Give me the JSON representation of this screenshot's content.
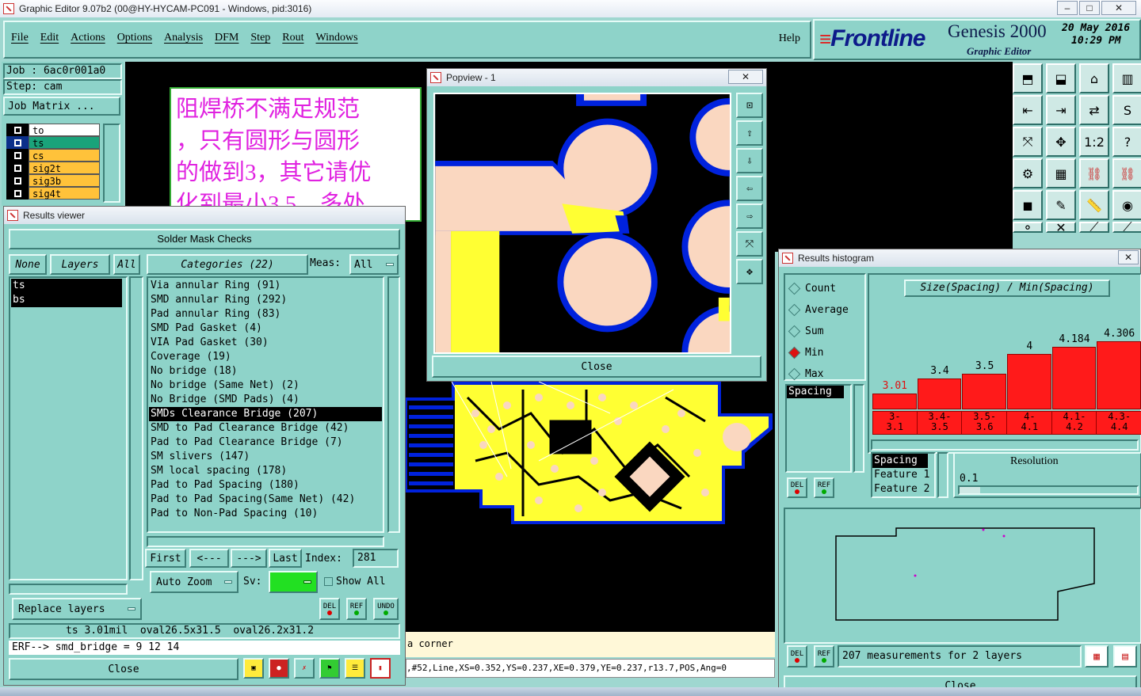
{
  "window": {
    "title": "Graphic Editor 9.07b2 (00@HY-HYCAM-PC091 - Windows, pid:3016)"
  },
  "menu": [
    "File",
    "Edit",
    "Actions",
    "Options",
    "Analysis",
    "DFM",
    "Step",
    "Rout",
    "Windows"
  ],
  "help": "Help",
  "brand": {
    "logo": "Frontline",
    "product": "Genesis 2000",
    "subtitle": "Graphic Editor",
    "date": "20 May 2016",
    "time": "10:29 PM"
  },
  "job": {
    "job": "Job : 6ac0r001a0",
    "step": "Step: cam",
    "matrix_button": "Job Matrix ..."
  },
  "layers": [
    {
      "name": "to",
      "color": "#ffffff"
    },
    {
      "name": "ts",
      "color": "#1aa37a"
    },
    {
      "name": "cs",
      "color": "#ffc23a"
    },
    {
      "name": "sig2t",
      "color": "#ffc23a"
    },
    {
      "name": "sig3b",
      "color": "#ffc23a"
    },
    {
      "name": "sig4t",
      "color": "#ffc23a"
    }
  ],
  "note": {
    "line1": "阻焊桥不满足规范",
    "line2": "，只有圆形与圆形",
    "line3": "的做到3，其它请优",
    "line4": "化到最小3.5，多处"
  },
  "results_viewer": {
    "title": "Results viewer",
    "header": "Solder Mask Checks",
    "btn_none": "None",
    "btn_layers": "Layers",
    "btn_all": "All",
    "categories_btn": "Categories (22)",
    "meas_label": "Meas:",
    "meas_value": "All",
    "layer_items": [
      "ts",
      "bs"
    ],
    "categories": [
      "Via annular Ring (91)",
      "SMD annular Ring (292)",
      "Pad annular Ring (83)",
      "SMD Pad Gasket (4)",
      "VIA Pad Gasket (30)",
      "Coverage (19)",
      "No bridge (18)",
      "No bridge (Same Net) (2)",
      "No Bridge (SMD Pads) (4)",
      "SMDs Clearance Bridge (207)",
      "SMD to Pad Clearance Bridge (42)",
      "Pad to Pad Clearance Bridge (7)",
      "SM slivers (147)",
      "SM local spacing (178)",
      "Pad to Pad Spacing (180)",
      "Pad to Pad Spacing(Same Net) (42)",
      "Pad to Non-Pad Spacing (10)"
    ],
    "selected_category": 9,
    "nav": {
      "first": "First",
      "prev": "<---",
      "next": "--->",
      "last": "Last",
      "index_label": "Index:",
      "index_value": "281"
    },
    "auto_zoom": "Auto Zoom",
    "sv_label": "Sv:",
    "show_all": "Show All",
    "replace_layers": "Replace layers",
    "del": "DEL",
    "ref": "REF",
    "undo": "UNDO",
    "status": "ts 3.01mil  oval26.5x31.5  oval26.2x31.2",
    "erf": "ERF--> smd_bridge = 9 12 14",
    "close": "Close"
  },
  "popview": {
    "title": "Popview - 1",
    "close": "Close"
  },
  "histogram": {
    "title": "Results histogram",
    "modes": [
      "Count",
      "Average",
      "Sum",
      "Min",
      "Max"
    ],
    "selected_mode": "Min",
    "chart_title": "Size(Spacing) / Min(Spacing)",
    "list_item": "Spacing",
    "bins": [
      {
        "range": "3-\n3.1",
        "value": 3.01,
        "label": "3.01"
      },
      {
        "range": "3.4-\n3.5",
        "value": 3.4,
        "label": "3.4"
      },
      {
        "range": "3.5-\n3.6",
        "value": 3.5,
        "label": "3.5"
      },
      {
        "range": "4-\n4.1",
        "value": 4,
        "label": "4"
      },
      {
        "range": "4.1-\n4.2",
        "value": 4.184,
        "label": "4.184"
      },
      {
        "range": "4.3-\n4.4",
        "value": 4.306,
        "label": "4.306"
      }
    ],
    "fields": [
      "Spacing",
      "Feature 1",
      "Feature 2"
    ],
    "resolution_label": "Resolution",
    "resolution_value": "0.1",
    "measurements": "207 measurements for 2 layers",
    "close": "Close"
  },
  "bottom_status": {
    "corner": "a corner",
    "coords": ",#52,Line,XS=0.352,YS=0.237,XE=0.379,YE=0.237,r13.7,POS,Ang=0"
  },
  "colors": {
    "teal": "#8ed3c9",
    "pcb_yellow": "#ffff33",
    "pad": "#fad7c0",
    "mask_blue": "#0022dd",
    "bar_red": "#ff1a1a"
  }
}
